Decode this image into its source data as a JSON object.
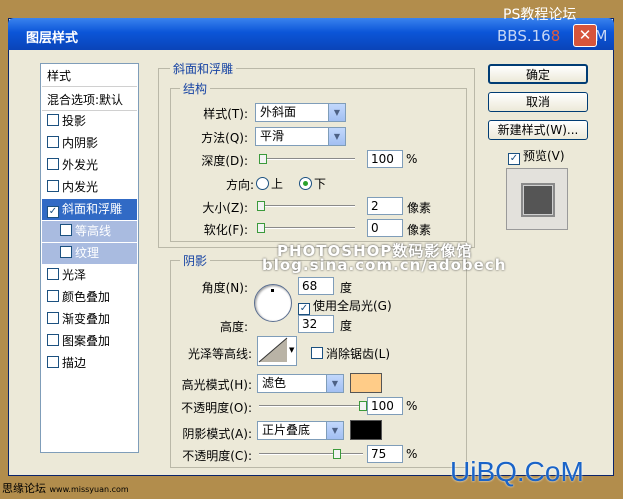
{
  "watermark": {
    "top_right": "PS教程论坛",
    "bbs": "BBS.16",
    "bbs_tail": "COM",
    "overlay_line1": "PHOTOSHOP数码影像馆",
    "overlay_line2": "blog.sina.com.cn/adobech",
    "bottom_left": "思缘论坛",
    "bottom_left_url": "www.missyuan.com",
    "bottom_right": "UiBQ.CoM"
  },
  "window": {
    "title": "图层样式",
    "close": "✕"
  },
  "left_panel": {
    "header": "样式",
    "blend": "混合选项:默认",
    "items": [
      {
        "label": "投影",
        "checked": false
      },
      {
        "label": "内阴影",
        "checked": false
      },
      {
        "label": "外发光",
        "checked": false
      },
      {
        "label": "内发光",
        "checked": false
      },
      {
        "label": "斜面和浮雕",
        "checked": true
      },
      {
        "label": "等高线",
        "checked": false
      },
      {
        "label": "纹理",
        "checked": false
      },
      {
        "label": "光泽",
        "checked": false
      },
      {
        "label": "颜色叠加",
        "checked": false
      },
      {
        "label": "渐变叠加",
        "checked": false
      },
      {
        "label": "图案叠加",
        "checked": false
      },
      {
        "label": "描边",
        "checked": false
      }
    ]
  },
  "bevel": {
    "group_title": "斜面和浮雕",
    "structure_title": "结构",
    "style_label": "样式(T):",
    "style_value": "外斜面",
    "method_label": "方法(Q):",
    "method_value": "平滑",
    "depth_label": "深度(D):",
    "depth_value": "100",
    "depth_unit": "%",
    "depth_level": 0.04,
    "direction_label": "方向:",
    "dir_up": "上",
    "dir_down": "下",
    "dir_selected": "down",
    "size_label": "大小(Z):",
    "size_value": "2",
    "size_unit": "像素",
    "soften_label": "软化(F):",
    "soften_value": "0",
    "soften_unit": "像素"
  },
  "shading": {
    "title": "阴影",
    "angle_label": "角度(N):",
    "angle_value": "68",
    "angle_unit": "度",
    "global_light": "使用全局光(G)",
    "global_checked": true,
    "altitude_label": "高度:",
    "altitude_value": "32",
    "altitude_unit": "度",
    "gloss_label": "光泽等高线:",
    "antialias": "消除锯齿(L)",
    "highlight_label": "高光模式(H):",
    "highlight_mode": "滤色",
    "highlight_color": "#ffcc88",
    "hl_opacity_label": "不透明度(O):",
    "hl_opacity_value": "100",
    "hl_opacity_unit": "%",
    "hl_opacity_level": 1.0,
    "shadow_label": "阴影模式(A):",
    "shadow_mode": "正片叠底",
    "shadow_color": "#000000",
    "sh_opacity_label": "不透明度(C):",
    "sh_opacity_value": "75",
    "sh_opacity_unit": "%",
    "sh_opacity_level": 0.75
  },
  "buttons": {
    "ok": "确定",
    "cancel": "取消",
    "new_style": "新建样式(W)...",
    "preview": "预览(V)",
    "preview_checked": true
  }
}
